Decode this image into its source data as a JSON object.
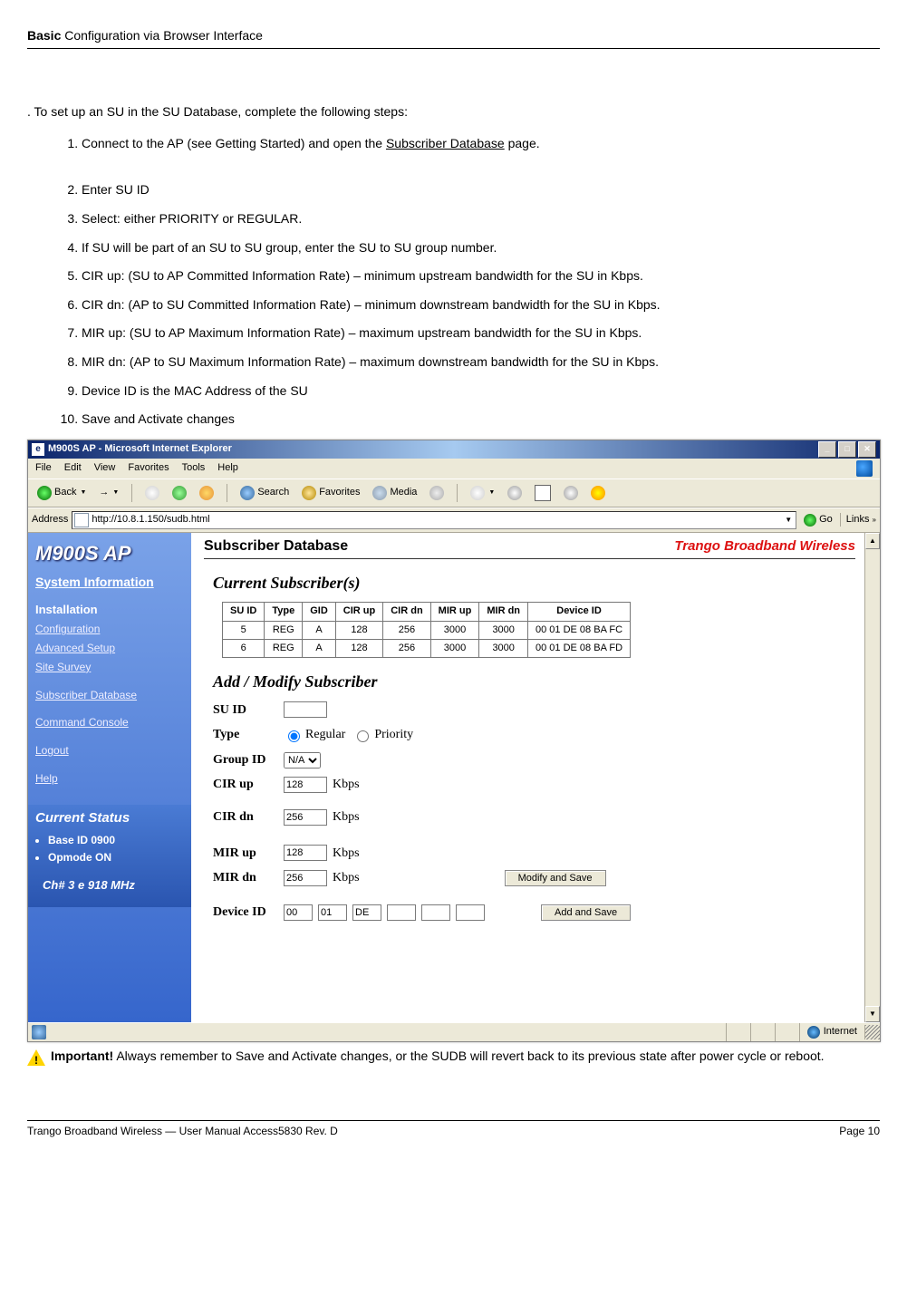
{
  "doc": {
    "header_bold": "Basic",
    "header_rest": " Configuration via Browser Interface",
    "intro": ". To set up an SU in the SU Database, complete the following steps:",
    "steps": [
      "Connect to the AP (see Getting Started) and open the ",
      "Enter SU ID",
      "Select: either PRIORITY or REGULAR.",
      "If SU will be part of an SU to SU group, enter the SU to SU group number.",
      "CIR up: (SU to AP Committed Information Rate) – minimum upstream bandwidth for the SU in Kbps.",
      "CIR dn: (AP to SU Committed Information Rate) – minimum downstream bandwidth for the SU in Kbps.",
      "MIR up: (SU to AP Maximum Information Rate) – maximum upstream bandwidth for the SU in Kbps.",
      "MIR dn: (AP to SU Maximum Information Rate) – maximum downstream bandwidth for the SU in Kbps.",
      "Device ID is the MAC Address of the SU",
      "Save and Activate changes"
    ],
    "step1_link": "Subscriber Database",
    "step1_tail": " page.",
    "important_bold": "Important!",
    "important_rest": "  Always remember to Save and Activate changes, or the SUDB will revert back to its previous state after power cycle or reboot.",
    "footer_left": "Trango Broadband Wireless — User Manual Access5830  Rev. D",
    "footer_right": "Page 10"
  },
  "win": {
    "title": "M900S AP - Microsoft Internet Explorer",
    "menu": {
      "file": "File",
      "edit": "Edit",
      "view": "View",
      "favorites": "Favorites",
      "tools": "Tools",
      "help": "Help"
    },
    "tb": {
      "back": "Back",
      "search": "Search",
      "favorites": "Favorites",
      "media": "Media"
    },
    "addr_label": "Address",
    "addr_url": "http://10.8.1.150/sudb.html",
    "go": "Go",
    "links": "Links",
    "status_zone": "Internet"
  },
  "sidebar": {
    "brand": "M900S AP",
    "sysinfo": "System Information",
    "install": "Installation",
    "nav": {
      "config": "Configuration",
      "adv": "Advanced Setup",
      "site": "Site Survey",
      "sudb": "Subscriber Database",
      "cmd": "Command Console",
      "logout": "Logout",
      "help": "Help"
    },
    "cur_status": "Current Status",
    "items": {
      "base": "Base ID   0900",
      "op": "Opmode   ON"
    },
    "ch": "Ch# 3 e 918 MHz"
  },
  "main": {
    "title": "Subscriber Database",
    "brand_right": "Trango Broadband Wireless",
    "cur_subs": "Current Subscriber(s)",
    "table": {
      "headers": [
        "SU ID",
        "Type",
        "GID",
        "CIR up",
        "CIR dn",
        "MIR up",
        "MIR dn",
        "Device ID"
      ],
      "rows": [
        [
          "5",
          "REG",
          "A",
          "128",
          "256",
          "3000",
          "3000",
          "00 01 DE 08 BA FC"
        ],
        [
          "6",
          "REG",
          "A",
          "128",
          "256",
          "3000",
          "3000",
          "00 01 DE 08 BA FD"
        ]
      ]
    },
    "add_mod": "Add / Modify Subscriber",
    "form": {
      "su_id": "SU ID",
      "type": "Type",
      "regular": "Regular",
      "priority": "Priority",
      "group": "Group ID",
      "group_val": "N/A",
      "cir_up": "CIR up",
      "cir_up_val": "128",
      "cir_dn": "CIR dn",
      "cir_dn_val": "256",
      "mir_up": "MIR up",
      "mir_up_val": "128",
      "mir_dn": "MIR dn",
      "mir_dn_val": "256",
      "kbps": "Kbps",
      "device_id": "Device ID",
      "dev": [
        "00",
        "01",
        "DE",
        "",
        "",
        ""
      ],
      "modify_btn": "Modify and Save",
      "add_btn": "Add and Save"
    }
  }
}
